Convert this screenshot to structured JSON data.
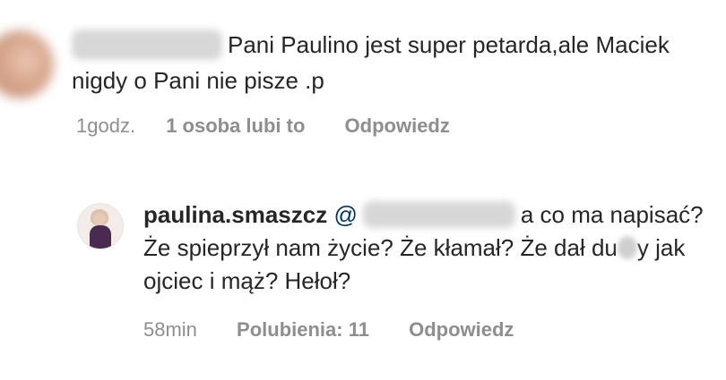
{
  "comment": {
    "text": "Pani Paulino jest super petarda,ale Maciek nigdy o Pani nie pisze .p",
    "time": "1godz.",
    "likes": "1 osoba lubi to",
    "reply_label": "Odpowiedz"
  },
  "reply": {
    "username": "paulina.smaszcz",
    "mention_prefix": "@",
    "text_part1": "a co ma napisać? Że spieprzył nam życie? Że kłamał? Że dał du",
    "text_part2": "y jak ojciec i mąż? Hełoł?",
    "time": "58min",
    "likes": "Polubienia: 11",
    "reply_label": "Odpowiedz"
  }
}
